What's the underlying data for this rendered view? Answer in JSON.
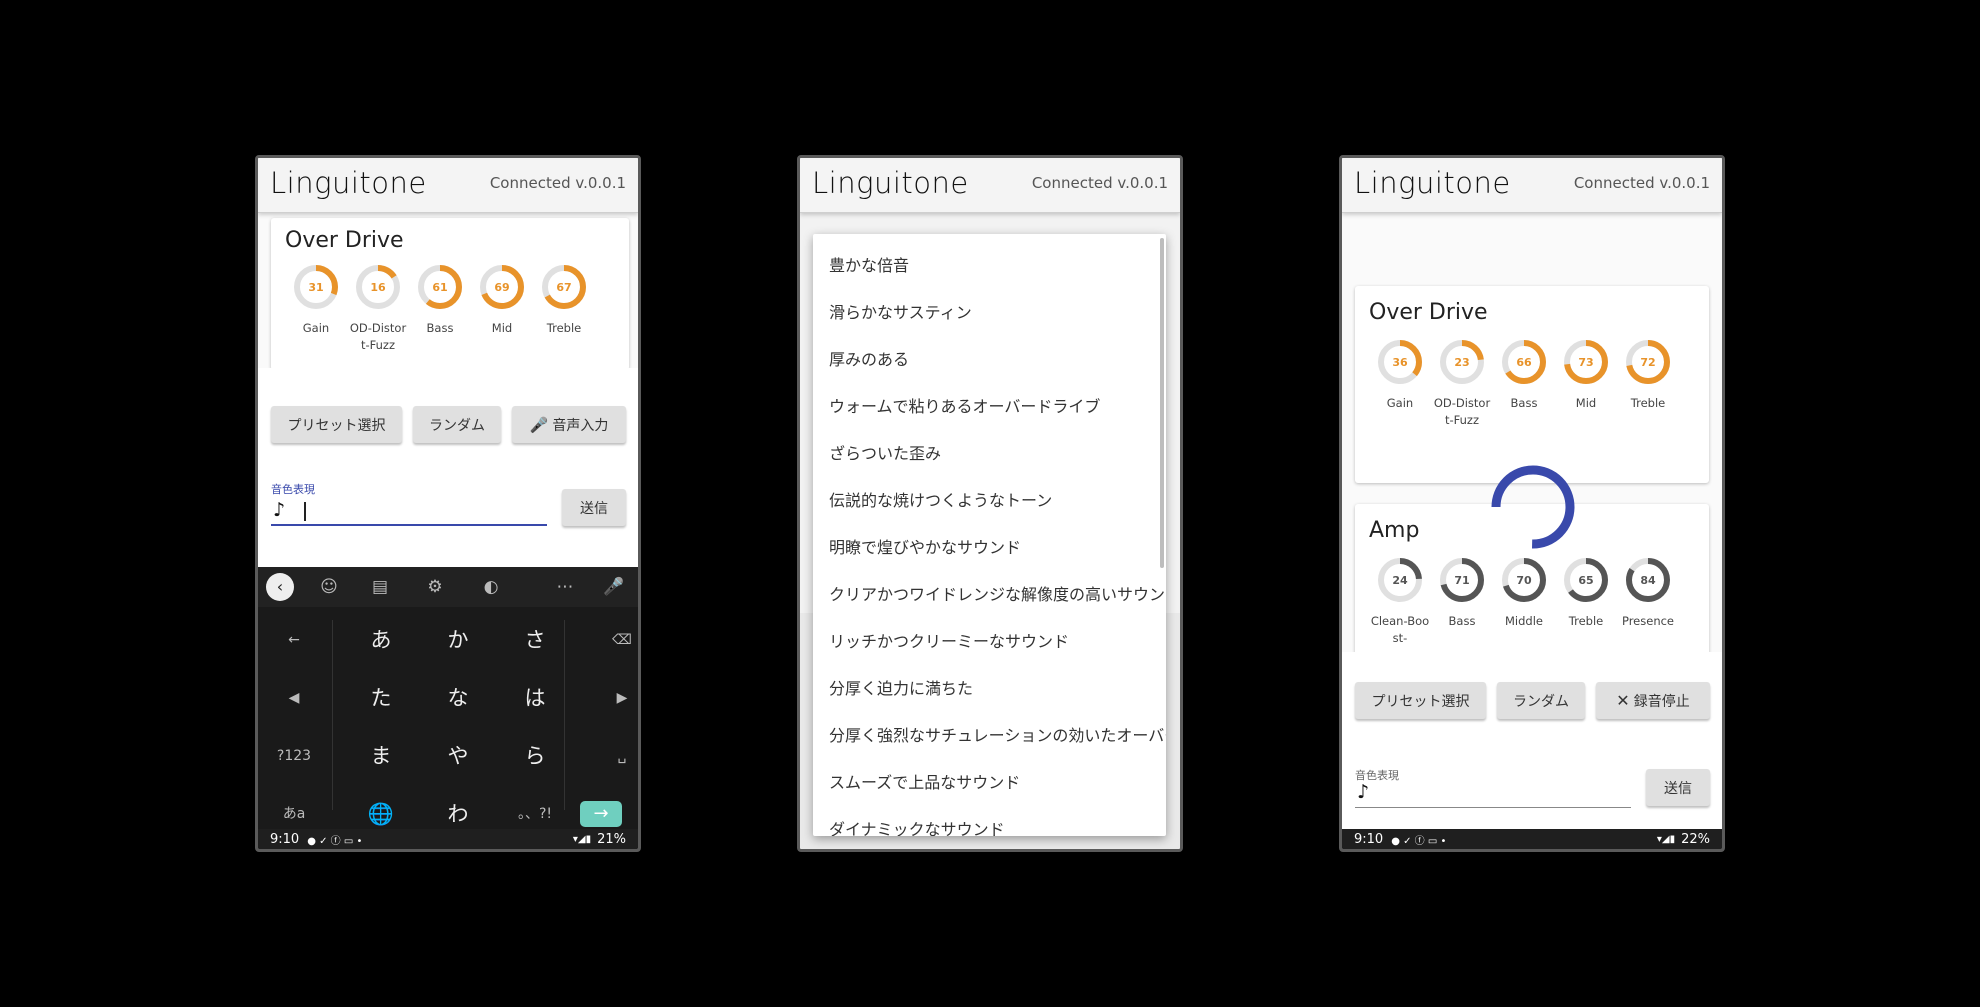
{
  "app": {
    "title": "Linguitone",
    "status": "Connected  v.0.0.1"
  },
  "screen1": {
    "overdrive": {
      "title": "Over Drive",
      "knobs": [
        {
          "label": "Gain",
          "value": 31
        },
        {
          "label": "OD-Distort-Fuzz",
          "value": 16
        },
        {
          "label": "Bass",
          "value": 61
        },
        {
          "label": "Mid",
          "value": 69
        },
        {
          "label": "Treble",
          "value": 67
        }
      ]
    },
    "buttons": {
      "preset": "プリセット選択",
      "random": "ランダム",
      "voice": "音声入力"
    },
    "input": {
      "label": "音色表現",
      "value": ""
    },
    "send": "送信",
    "keyboard": {
      "rows": [
        [
          "←",
          "あ",
          "か",
          "さ",
          "⌫"
        ],
        [
          "◀",
          "た",
          "な",
          "は",
          "▶"
        ],
        [
          "?123",
          "ま",
          "や",
          "ら",
          "␣"
        ],
        [
          "あa",
          "🌐",
          "わ",
          "。、?!",
          "→"
        ]
      ]
    },
    "statusbar": {
      "time": "9:10",
      "battery": "21%"
    }
  },
  "screen2": {
    "items": [
      "豊かな倍音",
      "滑らかなサスティン",
      "厚みのある",
      "ウォームで粘りあるオーバードライブ",
      "ざらついた歪み",
      "伝説的な焼けつくようなトーン",
      "明瞭で煌びやかなサウンド",
      "クリアかつワイドレンジな解像度の高いサウンド",
      "リッチかつクリーミーなサウンド",
      "分厚く迫力に満ちた",
      "分厚く強烈なサチュレーションの効いたオーバードライブ",
      "スムーズで上品なサウンド",
      "ダイナミックなサウンド"
    ]
  },
  "screen3": {
    "overdrive": {
      "title": "Over Drive",
      "knobs": [
        {
          "label": "Gain",
          "value": 36
        },
        {
          "label": "OD-Distort-Fuzz",
          "value": 23
        },
        {
          "label": "Bass",
          "value": 66
        },
        {
          "label": "Mid",
          "value": 73
        },
        {
          "label": "Treble",
          "value": 72
        }
      ]
    },
    "amp": {
      "title": "Amp",
      "knobs": [
        {
          "label": "Clean-Boost-",
          "value": 24
        },
        {
          "label": "Bass",
          "value": 71
        },
        {
          "label": "Middle",
          "value": 70
        },
        {
          "label": "Treble",
          "value": 65
        },
        {
          "label": "Presence",
          "value": 84
        }
      ]
    },
    "buttons": {
      "preset": "プリセット選択",
      "random": "ランダム",
      "stop": "録音停止"
    },
    "input": {
      "label": "音色表現",
      "value": ""
    },
    "send": "送信",
    "statusbar": {
      "time": "9:10",
      "battery": "22%"
    }
  },
  "colors": {
    "orange": "#e8932a",
    "dark": "#555555",
    "ring": "#e0e0e0",
    "indigo": "#3949ab"
  }
}
